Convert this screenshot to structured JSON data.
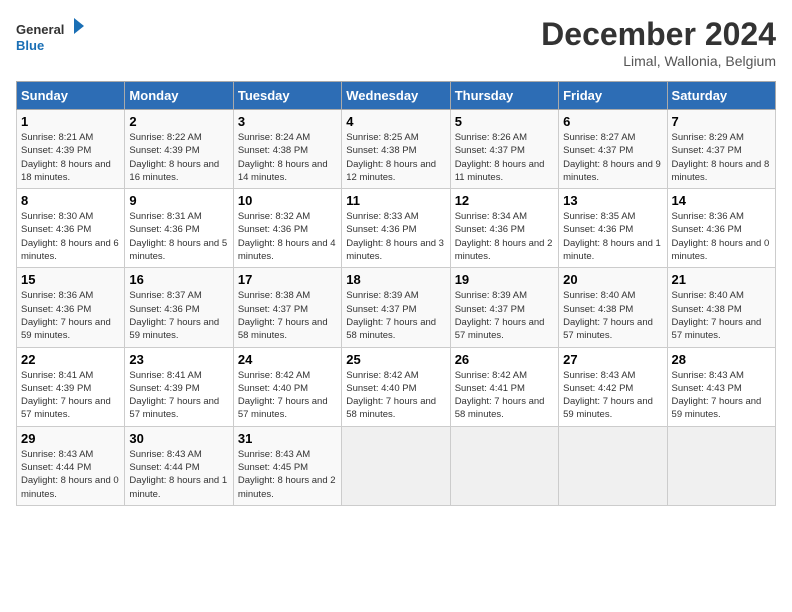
{
  "header": {
    "logo_line1": "General",
    "logo_line2": "Blue",
    "month_title": "December 2024",
    "subtitle": "Limal, Wallonia, Belgium"
  },
  "weekdays": [
    "Sunday",
    "Monday",
    "Tuesday",
    "Wednesday",
    "Thursday",
    "Friday",
    "Saturday"
  ],
  "weeks": [
    [
      {
        "day": "1",
        "detail": "Sunrise: 8:21 AM\nSunset: 4:39 PM\nDaylight: 8 hours and 18 minutes."
      },
      {
        "day": "2",
        "detail": "Sunrise: 8:22 AM\nSunset: 4:39 PM\nDaylight: 8 hours and 16 minutes."
      },
      {
        "day": "3",
        "detail": "Sunrise: 8:24 AM\nSunset: 4:38 PM\nDaylight: 8 hours and 14 minutes."
      },
      {
        "day": "4",
        "detail": "Sunrise: 8:25 AM\nSunset: 4:38 PM\nDaylight: 8 hours and 12 minutes."
      },
      {
        "day": "5",
        "detail": "Sunrise: 8:26 AM\nSunset: 4:37 PM\nDaylight: 8 hours and 11 minutes."
      },
      {
        "day": "6",
        "detail": "Sunrise: 8:27 AM\nSunset: 4:37 PM\nDaylight: 8 hours and 9 minutes."
      },
      {
        "day": "7",
        "detail": "Sunrise: 8:29 AM\nSunset: 4:37 PM\nDaylight: 8 hours and 8 minutes."
      }
    ],
    [
      {
        "day": "8",
        "detail": "Sunrise: 8:30 AM\nSunset: 4:36 PM\nDaylight: 8 hours and 6 minutes."
      },
      {
        "day": "9",
        "detail": "Sunrise: 8:31 AM\nSunset: 4:36 PM\nDaylight: 8 hours and 5 minutes."
      },
      {
        "day": "10",
        "detail": "Sunrise: 8:32 AM\nSunset: 4:36 PM\nDaylight: 8 hours and 4 minutes."
      },
      {
        "day": "11",
        "detail": "Sunrise: 8:33 AM\nSunset: 4:36 PM\nDaylight: 8 hours and 3 minutes."
      },
      {
        "day": "12",
        "detail": "Sunrise: 8:34 AM\nSunset: 4:36 PM\nDaylight: 8 hours and 2 minutes."
      },
      {
        "day": "13",
        "detail": "Sunrise: 8:35 AM\nSunset: 4:36 PM\nDaylight: 8 hours and 1 minute."
      },
      {
        "day": "14",
        "detail": "Sunrise: 8:36 AM\nSunset: 4:36 PM\nDaylight: 8 hours and 0 minutes."
      }
    ],
    [
      {
        "day": "15",
        "detail": "Sunrise: 8:36 AM\nSunset: 4:36 PM\nDaylight: 7 hours and 59 minutes."
      },
      {
        "day": "16",
        "detail": "Sunrise: 8:37 AM\nSunset: 4:36 PM\nDaylight: 7 hours and 59 minutes."
      },
      {
        "day": "17",
        "detail": "Sunrise: 8:38 AM\nSunset: 4:37 PM\nDaylight: 7 hours and 58 minutes."
      },
      {
        "day": "18",
        "detail": "Sunrise: 8:39 AM\nSunset: 4:37 PM\nDaylight: 7 hours and 58 minutes."
      },
      {
        "day": "19",
        "detail": "Sunrise: 8:39 AM\nSunset: 4:37 PM\nDaylight: 7 hours and 57 minutes."
      },
      {
        "day": "20",
        "detail": "Sunrise: 8:40 AM\nSunset: 4:38 PM\nDaylight: 7 hours and 57 minutes."
      },
      {
        "day": "21",
        "detail": "Sunrise: 8:40 AM\nSunset: 4:38 PM\nDaylight: 7 hours and 57 minutes."
      }
    ],
    [
      {
        "day": "22",
        "detail": "Sunrise: 8:41 AM\nSunset: 4:39 PM\nDaylight: 7 hours and 57 minutes."
      },
      {
        "day": "23",
        "detail": "Sunrise: 8:41 AM\nSunset: 4:39 PM\nDaylight: 7 hours and 57 minutes."
      },
      {
        "day": "24",
        "detail": "Sunrise: 8:42 AM\nSunset: 4:40 PM\nDaylight: 7 hours and 57 minutes."
      },
      {
        "day": "25",
        "detail": "Sunrise: 8:42 AM\nSunset: 4:40 PM\nDaylight: 7 hours and 58 minutes."
      },
      {
        "day": "26",
        "detail": "Sunrise: 8:42 AM\nSunset: 4:41 PM\nDaylight: 7 hours and 58 minutes."
      },
      {
        "day": "27",
        "detail": "Sunrise: 8:43 AM\nSunset: 4:42 PM\nDaylight: 7 hours and 59 minutes."
      },
      {
        "day": "28",
        "detail": "Sunrise: 8:43 AM\nSunset: 4:43 PM\nDaylight: 7 hours and 59 minutes."
      }
    ],
    [
      {
        "day": "29",
        "detail": "Sunrise: 8:43 AM\nSunset: 4:44 PM\nDaylight: 8 hours and 0 minutes."
      },
      {
        "day": "30",
        "detail": "Sunrise: 8:43 AM\nSunset: 4:44 PM\nDaylight: 8 hours and 1 minute."
      },
      {
        "day": "31",
        "detail": "Sunrise: 8:43 AM\nSunset: 4:45 PM\nDaylight: 8 hours and 2 minutes."
      },
      null,
      null,
      null,
      null
    ]
  ]
}
